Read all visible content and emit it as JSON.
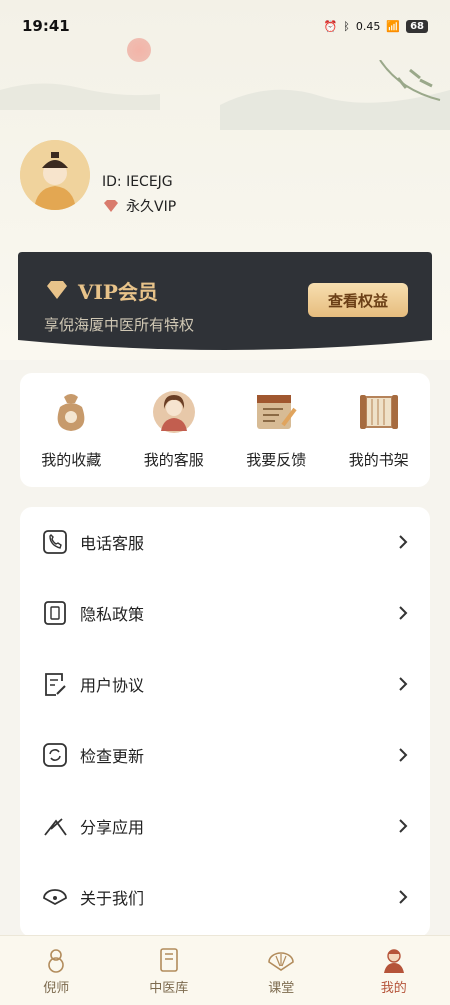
{
  "status_bar": {
    "time": "19:41",
    "net_speed": "0.45",
    "net_unit": "KB/S",
    "battery": "68"
  },
  "profile": {
    "id_text": "ID: IECEJG",
    "vip_status": "永久VIP"
  },
  "vip_card": {
    "title": "VIP会员",
    "subtitle": "享倪海厦中医所有特权",
    "button": "查看权益"
  },
  "quick_actions": [
    {
      "label": "我的收藏",
      "icon": "collection-bag-icon"
    },
    {
      "label": "我的客服",
      "icon": "customer-service-icon"
    },
    {
      "label": "我要反馈",
      "icon": "feedback-icon"
    },
    {
      "label": "我的书架",
      "icon": "bookshelf-icon"
    }
  ],
  "menu": [
    {
      "label": "电话客服",
      "icon": "phone-icon"
    },
    {
      "label": "隐私政策",
      "icon": "privacy-icon"
    },
    {
      "label": "用户协议",
      "icon": "agreement-icon"
    },
    {
      "label": "检查更新",
      "icon": "update-icon"
    },
    {
      "label": "分享应用",
      "icon": "share-icon"
    },
    {
      "label": "关于我们",
      "icon": "about-icon"
    }
  ],
  "tabs": [
    {
      "label": "倪师",
      "icon": "gourd-icon"
    },
    {
      "label": "中医库",
      "icon": "book-icon"
    },
    {
      "label": "课堂",
      "icon": "fan-icon"
    },
    {
      "label": "我的",
      "icon": "profile-icon"
    }
  ],
  "colors": {
    "gold": "#e8c38a",
    "card_dark": "#2f3237",
    "accent_red": "#b5543a"
  }
}
